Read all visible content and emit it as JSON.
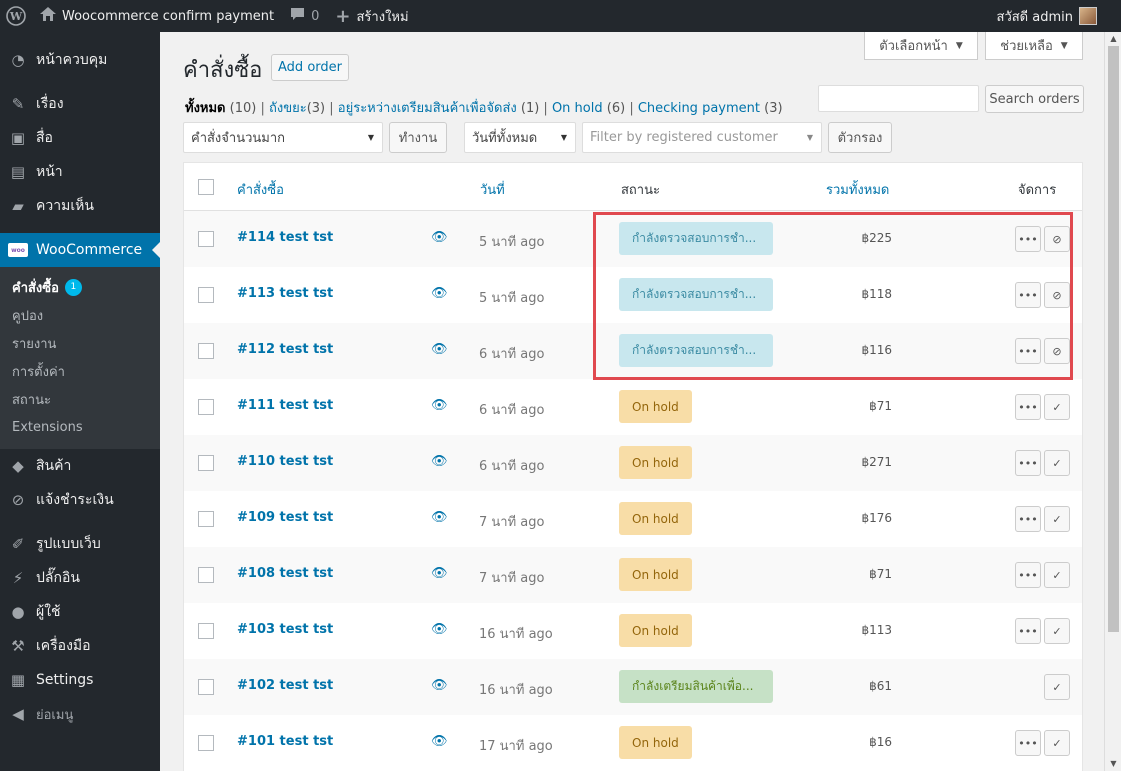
{
  "adminbar": {
    "site_name": "Woocommerce confirm payment",
    "comments_count": "0",
    "new_label": "สร้างใหม่",
    "greeting": "สวัสดี admin"
  },
  "sidebar": {
    "items_top": [
      {
        "label": "หน้าควบคุม",
        "icon": "dashboard-icon"
      },
      {
        "label": "เรื่อง",
        "icon": "pin-icon"
      },
      {
        "label": "สื่อ",
        "icon": "media-icon"
      },
      {
        "label": "หน้า",
        "icon": "page-icon"
      },
      {
        "label": "ความเห็น",
        "icon": "comment-icon"
      }
    ],
    "woocommerce_label": "WooCommerce",
    "woo_logo_text": "woo",
    "submenu": [
      {
        "label": "คำสั่งซื้อ",
        "badge": "1"
      },
      {
        "label": "คูปอง"
      },
      {
        "label": "รายงาน"
      },
      {
        "label": "การตั้งค่า"
      },
      {
        "label": "สถานะ"
      },
      {
        "label": "Extensions"
      }
    ],
    "items_mid": [
      {
        "label": "สินค้า",
        "icon": "box-icon"
      },
      {
        "label": "แจ้งชำระเงิน",
        "icon": "paperclip-icon"
      }
    ],
    "items_bottom": [
      {
        "label": "รูปแบบเว็บ",
        "icon": "brush-icon"
      },
      {
        "label": "ปลั๊กอิน",
        "icon": "plugin-icon"
      },
      {
        "label": "ผู้ใช้",
        "icon": "user-icon"
      },
      {
        "label": "เครื่องมือ",
        "icon": "wrench-icon"
      },
      {
        "label": "Settings",
        "icon": "settings-icon"
      },
      {
        "label": "ย่อเมนู",
        "icon": "collapse-icon"
      }
    ]
  },
  "screen_options_label": "ตัวเลือกหน้า",
  "help_label": "ช่วยเหลือ",
  "page_title": "คำสั่งซื้อ",
  "add_order_label": "Add order",
  "filters_status": [
    {
      "label": "ทั้งหมด",
      "count": "(10)"
    },
    {
      "label": "ถังขยะ",
      "count": "(3)"
    },
    {
      "label": "อยู่ระหว่างเตรียมสินค้าเพื่อจัดส่ง",
      "count": "(1)"
    },
    {
      "label": "On hold",
      "count": "(6)"
    },
    {
      "label": "Checking payment",
      "count": "(3)"
    }
  ],
  "search": {
    "value": "",
    "button_label": "Search orders"
  },
  "bulk_action": {
    "selected": "คำสั่งจำนวนมาก",
    "apply_label": "ทำงาน"
  },
  "date_filter": {
    "selected": "วันที่ทั้งหมด"
  },
  "customer_filter": {
    "placeholder": "Filter by registered customer"
  },
  "filter_button_label": "ตัวกรอง",
  "table": {
    "headers": {
      "order": "คำสั่งซื้อ",
      "date": "วันที่",
      "status": "สถานะ",
      "total": "รวมทั้งหมด",
      "actions": "จัดการ"
    },
    "rows": [
      {
        "order": "#114 test tst",
        "date": "5 นาที ago",
        "status": "กำลังตรวจสอบการชำ...",
        "status_type": "checking",
        "total": "฿225",
        "actions": [
          "more-icon",
          "paperclip-icon"
        ]
      },
      {
        "order": "#113 test tst",
        "date": "5 นาที ago",
        "status": "กำลังตรวจสอบการชำ...",
        "status_type": "checking",
        "total": "฿118",
        "actions": [
          "more-icon",
          "paperclip-icon"
        ]
      },
      {
        "order": "#112 test tst",
        "date": "6 นาที ago",
        "status": "กำลังตรวจสอบการชำ...",
        "status_type": "checking",
        "total": "฿116",
        "actions": [
          "more-icon",
          "paperclip-icon"
        ]
      },
      {
        "order": "#111 test tst",
        "date": "6 นาที ago",
        "status": "On hold",
        "status_type": "onhold",
        "total": "฿71",
        "actions": [
          "more-icon",
          "check-icon"
        ]
      },
      {
        "order": "#110 test tst",
        "date": "6 นาที ago",
        "status": "On hold",
        "status_type": "onhold",
        "total": "฿271",
        "actions": [
          "more-icon",
          "check-icon"
        ]
      },
      {
        "order": "#109 test tst",
        "date": "7 นาที ago",
        "status": "On hold",
        "status_type": "onhold",
        "total": "฿176",
        "actions": [
          "more-icon",
          "check-icon"
        ]
      },
      {
        "order": "#108 test tst",
        "date": "7 นาที ago",
        "status": "On hold",
        "status_type": "onhold",
        "total": "฿71",
        "actions": [
          "more-icon",
          "check-icon"
        ]
      },
      {
        "order": "#103 test tst",
        "date": "16 นาที ago",
        "status": "On hold",
        "status_type": "onhold",
        "total": "฿113",
        "actions": [
          "more-icon",
          "check-icon"
        ]
      },
      {
        "order": "#102 test tst",
        "date": "16 นาที ago",
        "status": "กำลังเตรียมสินค้าเพื่อ...",
        "status_type": "processing",
        "total": "฿61",
        "actions": [
          "check-icon"
        ]
      },
      {
        "order": "#101 test tst",
        "date": "17 นาที ago",
        "status": "On hold",
        "status_type": "onhold",
        "total": "฿16",
        "actions": [
          "more-icon",
          "check-icon"
        ]
      }
    ]
  },
  "colors": {
    "admin_bar": "#23282d",
    "accent": "#0073aa",
    "highlight_box": "#e0494f"
  }
}
